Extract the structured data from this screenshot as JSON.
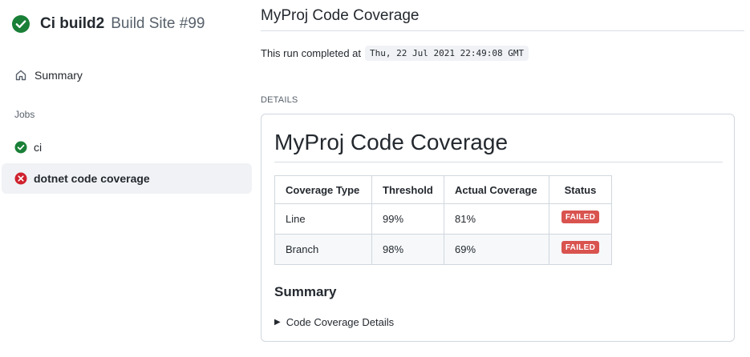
{
  "run": {
    "name": "Ci build2",
    "subtitle": "Build Site #99",
    "status_color": "#1a7f37"
  },
  "sidebar": {
    "summary_label": "Summary",
    "jobs_heading": "Jobs",
    "jobs": [
      {
        "label": "ci",
        "status": "success",
        "icon": "check-circle-icon",
        "color": "#1a7f37"
      },
      {
        "label": "dotnet code coverage",
        "status": "failure",
        "icon": "x-circle-icon",
        "color": "#cf222e",
        "selected": true
      }
    ]
  },
  "main": {
    "title": "MyProj Code Coverage",
    "completed_prefix": "This run completed at",
    "completed_time": "Thu, 22 Jul 2021 22:49:08 GMT",
    "details_label": "DETAILS",
    "report": {
      "heading": "MyProj Code Coverage",
      "table": {
        "headers": [
          "Coverage Type",
          "Threshold",
          "Actual Coverage",
          "Status"
        ],
        "rows": [
          [
            "Line",
            "99%",
            "81%",
            "FAILED"
          ],
          [
            "Branch",
            "98%",
            "69%",
            "FAILED"
          ]
        ]
      },
      "summary_heading": "Summary",
      "details_toggle": "Code Coverage Details",
      "failed_color": "#d9534f"
    }
  }
}
